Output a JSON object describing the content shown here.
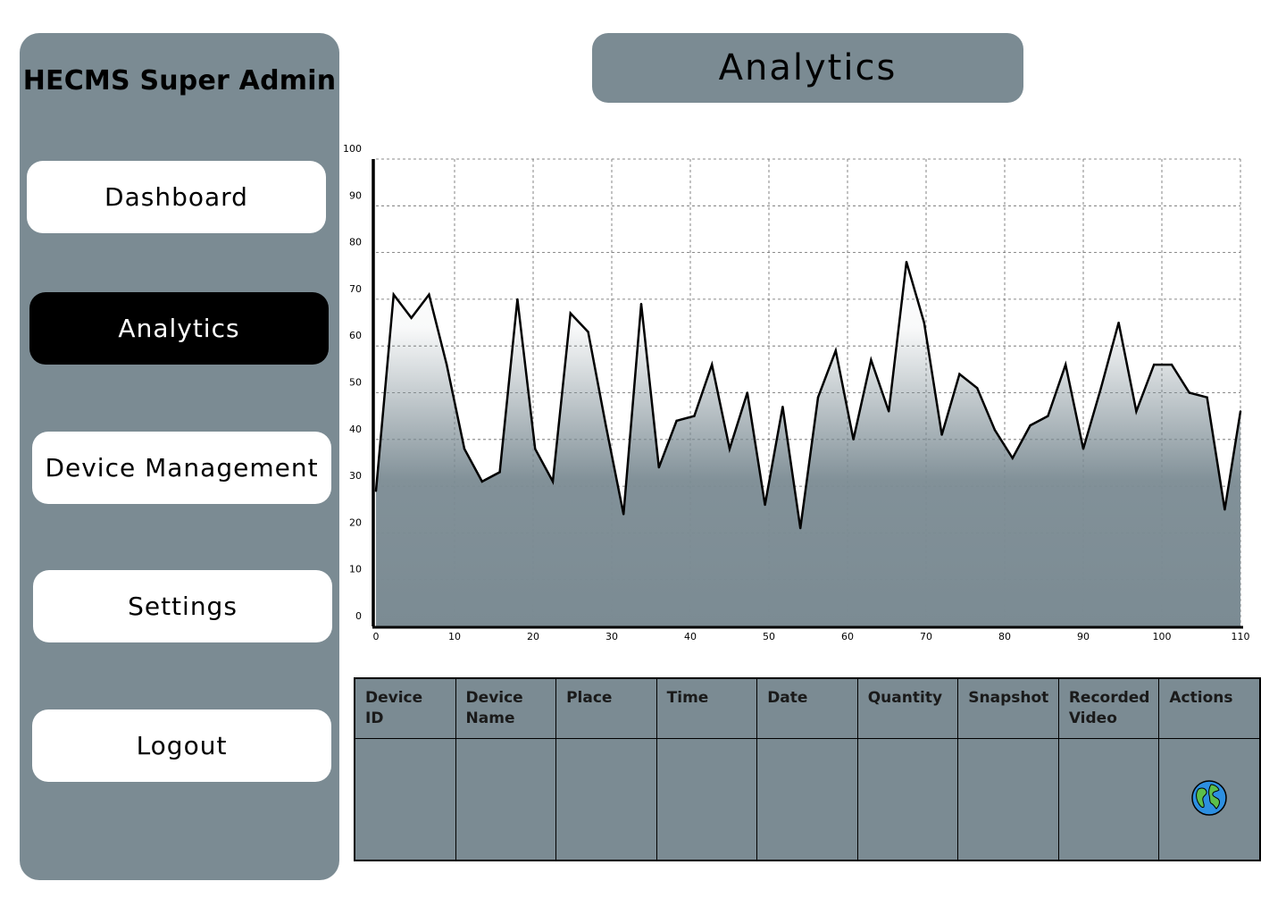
{
  "sidebar": {
    "title": "HECMS Super Admin",
    "items": [
      {
        "label": "Dashboard",
        "active": false
      },
      {
        "label": "Analytics",
        "active": true
      },
      {
        "label": "Device Management",
        "active": false
      },
      {
        "label": "Settings",
        "active": false
      },
      {
        "label": "Logout",
        "active": false
      }
    ]
  },
  "header": {
    "title": "Analytics"
  },
  "colors": {
    "panel": "#7b8b93",
    "active_nav": "#000000",
    "button": "#ffffff",
    "line": "#000000"
  },
  "chart_data": {
    "type": "area",
    "xlim": [
      0,
      110
    ],
    "ylim": [
      0,
      100
    ],
    "x_ticks": [
      0,
      10,
      20,
      30,
      40,
      50,
      60,
      70,
      80,
      90,
      100,
      110
    ],
    "y_ticks": [
      0,
      10,
      20,
      30,
      40,
      50,
      60,
      70,
      80,
      90,
      100
    ],
    "grid": true,
    "x": [
      0,
      2.25,
      4.5,
      6.75,
      9,
      11.25,
      13.5,
      15.75,
      18,
      20.25,
      22.5,
      24.75,
      27,
      29.25,
      31.5,
      33.75,
      36,
      38.25,
      40.5,
      42.75,
      45,
      47.25,
      49.5,
      51.75,
      54,
      56.25,
      58.5,
      60.75,
      63,
      65.25,
      67.5,
      69.75,
      72,
      74.25,
      76.5,
      78.75,
      81,
      83.25,
      85.5,
      87.75,
      90,
      92.25,
      94.5,
      96.75,
      99,
      101.25,
      103.5,
      105.75,
      108,
      110
    ],
    "y": [
      29,
      71,
      66,
      71,
      56,
      38,
      31,
      33,
      70,
      38,
      31,
      67,
      63,
      43,
      24,
      69,
      34,
      44,
      45,
      56,
      38,
      50,
      26,
      47,
      21,
      49,
      59,
      40,
      57,
      46,
      78,
      65,
      41,
      54,
      51,
      42,
      36,
      43,
      45,
      56,
      38,
      51,
      65,
      46,
      56,
      56,
      50,
      49,
      25,
      46
    ]
  },
  "table": {
    "columns": [
      "Device ID",
      "Device Name",
      "Place",
      "Time",
      "Date",
      "Quantity",
      "Snapshot",
      "Recorded Video",
      "Actions"
    ],
    "rows": [
      {
        "action_icon": "globe-icon"
      }
    ]
  }
}
